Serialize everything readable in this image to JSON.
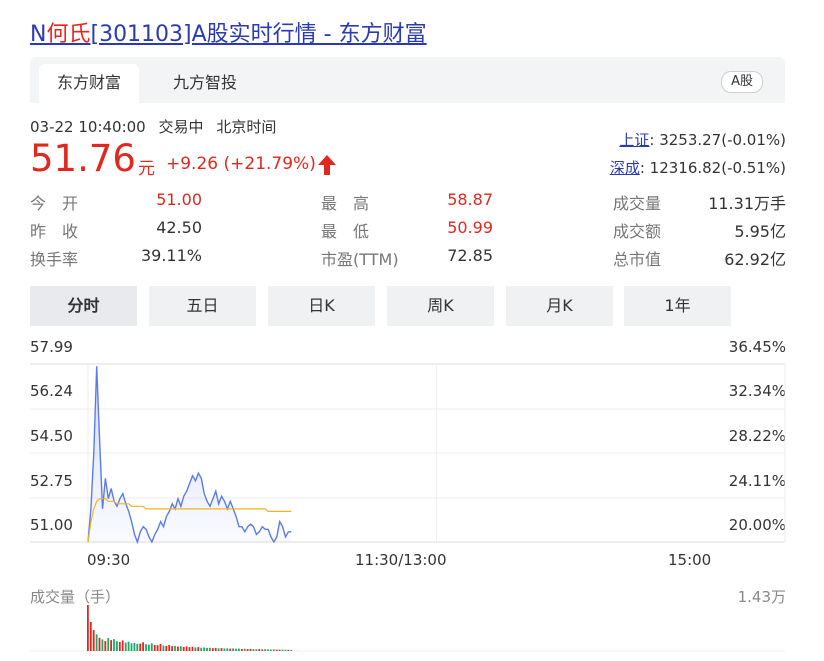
{
  "page": {
    "title_prefix": "N",
    "title_name": "何氏",
    "title_suffix": "[301103]A股实时行情 - 东方财富"
  },
  "tabs": {
    "active": "东方财富",
    "second": "九方智投",
    "tag": "A股"
  },
  "status": {
    "time": "03-22 10:40:00",
    "state": "交易中",
    "zone": "北京时间"
  },
  "quote": {
    "price": "51.76",
    "unit": "元",
    "change": "+9.26 (+21.79%)",
    "up_color": "#e0281e"
  },
  "indices": [
    {
      "label": "上证",
      "value": ": 3253.27(-0.01%)"
    },
    {
      "label": "深成",
      "value": ": 12316.82(-0.51%)"
    }
  ],
  "stats": {
    "col1": [
      {
        "label": "今　开",
        "value": "51.00"
      },
      {
        "label": "昨　收",
        "value": "42.50"
      },
      {
        "label": "换手率",
        "value": "39.11%"
      }
    ],
    "col2": [
      {
        "label": "最　高",
        "value": "58.87"
      },
      {
        "label": "最　低",
        "value": "50.99"
      },
      {
        "label": "市盈(TTM)",
        "value": "72.85"
      }
    ],
    "col3": [
      {
        "label": "成交量",
        "value": "11.31万手"
      },
      {
        "label": "成交额",
        "value": "5.95亿"
      },
      {
        "label": "总市值",
        "value": "62.92亿"
      }
    ]
  },
  "period_buttons": [
    "分时",
    "五日",
    "日K",
    "周K",
    "月K",
    "1年"
  ],
  "chart": {
    "y_left": [
      "57.99",
      "56.24",
      "54.50",
      "52.75",
      "51.00"
    ],
    "y_right": [
      "36.45%",
      "32.34%",
      "28.22%",
      "24.11%",
      "20.00%"
    ],
    "x_labels": [
      "09:30",
      "11:30/13:00",
      "15:00"
    ],
    "volume_label": "成交量（手）",
    "volume_max": "1.43万",
    "line_color": "#5b7ce8",
    "avg_color": "#f0b323",
    "price_range": [
      51.0,
      57.99
    ]
  },
  "chart_data": {
    "type": "line",
    "title": "",
    "xlabel": "",
    "ylabel": "",
    "ylim": [
      51.0,
      57.99
    ],
    "x": [
      "09:30",
      "09:31",
      "09:32",
      "09:33",
      "09:34",
      "09:35",
      "09:36",
      "09:37",
      "09:38",
      "09:39",
      "09:40",
      "09:41",
      "09:42",
      "09:43",
      "09:44",
      "09:45",
      "09:46",
      "09:47",
      "09:48",
      "09:49",
      "09:50",
      "09:51",
      "09:52",
      "09:53",
      "09:54",
      "09:55",
      "09:56",
      "09:57",
      "09:58",
      "09:59",
      "10:00",
      "10:01",
      "10:02",
      "10:03",
      "10:04",
      "10:05",
      "10:06",
      "10:07",
      "10:08",
      "10:09",
      "10:10",
      "10:11",
      "10:12",
      "10:13",
      "10:14",
      "10:15",
      "10:16",
      "10:17",
      "10:18",
      "10:19",
      "10:20",
      "10:21",
      "10:22",
      "10:23",
      "10:24",
      "10:25",
      "10:26",
      "10:27",
      "10:28",
      "10:29",
      "10:30",
      "10:31",
      "10:32",
      "10:33",
      "10:34",
      "10:35",
      "10:36",
      "10:37",
      "10:38",
      "10:39",
      "10:40"
    ],
    "series": [
      {
        "values": [
          51.0,
          52.3,
          54.5,
          57.9,
          55.0,
          52.3,
          53.5,
          52.7,
          53.1,
          52.6,
          52.4,
          52.7,
          52.9,
          52.5,
          52.2,
          51.8,
          51.3,
          51.0,
          51.4,
          51.6,
          51.5,
          51.2,
          51.0,
          51.3,
          51.5,
          51.8,
          51.6,
          52.0,
          52.2,
          52.5,
          52.3,
          52.7,
          52.4,
          52.8,
          53.0,
          53.3,
          53.6,
          53.4,
          53.7,
          53.5,
          52.9,
          52.6,
          52.4,
          52.7,
          53.0,
          52.5,
          52.8,
          52.6,
          52.3,
          52.6,
          52.3,
          52.0,
          51.6,
          51.6,
          51.4,
          51.6,
          51.7,
          51.6,
          51.3,
          51.4,
          51.6,
          51.5,
          51.5,
          51.2,
          51.0,
          51.2,
          51.8,
          51.6,
          51.2,
          51.4,
          51.4
        ]
      },
      {
        "values": [
          51.0,
          51.8,
          52.3,
          52.6,
          52.7,
          52.7,
          52.7,
          52.6,
          52.6,
          52.6,
          52.5,
          52.5,
          52.5,
          52.5,
          52.5,
          52.4,
          52.4,
          52.4,
          52.4,
          52.4,
          52.3,
          52.3,
          52.3,
          52.3,
          52.3,
          52.3,
          52.3,
          52.3,
          52.3,
          52.3,
          52.3,
          52.3,
          52.3,
          52.3,
          52.3,
          52.3,
          52.3,
          52.3,
          52.3,
          52.3,
          52.3,
          52.3,
          52.3,
          52.3,
          52.3,
          52.3,
          52.3,
          52.3,
          52.3,
          52.3,
          52.3,
          52.3,
          52.3,
          52.3,
          52.3,
          52.3,
          52.3,
          52.3,
          52.3,
          52.3,
          52.3,
          52.3,
          52.2,
          52.2,
          52.2,
          52.2,
          52.2,
          52.2,
          52.2,
          52.2,
          52.2
        ]
      }
    ],
    "volume": [
      14300,
      9000,
      6500,
      5200,
      4100,
      3600,
      3100,
      4000,
      3400,
      3700,
      3000,
      2800,
      3300,
      2600,
      2900,
      2400,
      2500,
      2200,
      2300,
      2700,
      2100,
      2000,
      2400,
      1900,
      1800,
      2200,
      1700,
      1600,
      1900,
      1500,
      1600,
      1400,
      1500,
      1300,
      1400,
      1200,
      1300,
      1100,
      1200,
      1000,
      1100,
      950,
      1000,
      900,
      950,
      850,
      900,
      800,
      850,
      750,
      800,
      700,
      750,
      650,
      700,
      600,
      650,
      600,
      550,
      600,
      500,
      550,
      500,
      450,
      500,
      450,
      400,
      450,
      400,
      380,
      350
    ],
    "volume_colors": [
      "r",
      "r",
      "r",
      "g",
      "r",
      "g",
      "r",
      "g",
      "r",
      "g",
      "g",
      "r",
      "r",
      "g",
      "g",
      "g",
      "g",
      "g",
      "r",
      "r",
      "g",
      "g",
      "g",
      "r",
      "r",
      "r",
      "g",
      "r",
      "r",
      "r",
      "g",
      "r",
      "g",
      "r",
      "r",
      "r",
      "r",
      "g",
      "r",
      "g",
      "g",
      "g",
      "g",
      "r",
      "r",
      "g",
      "r",
      "g",
      "g",
      "r",
      "g",
      "g",
      "g",
      "r",
      "g",
      "r",
      "r",
      "g",
      "g",
      "r",
      "r",
      "g",
      "g",
      "g",
      "g",
      "r",
      "r",
      "g",
      "g",
      "r",
      "g"
    ]
  }
}
